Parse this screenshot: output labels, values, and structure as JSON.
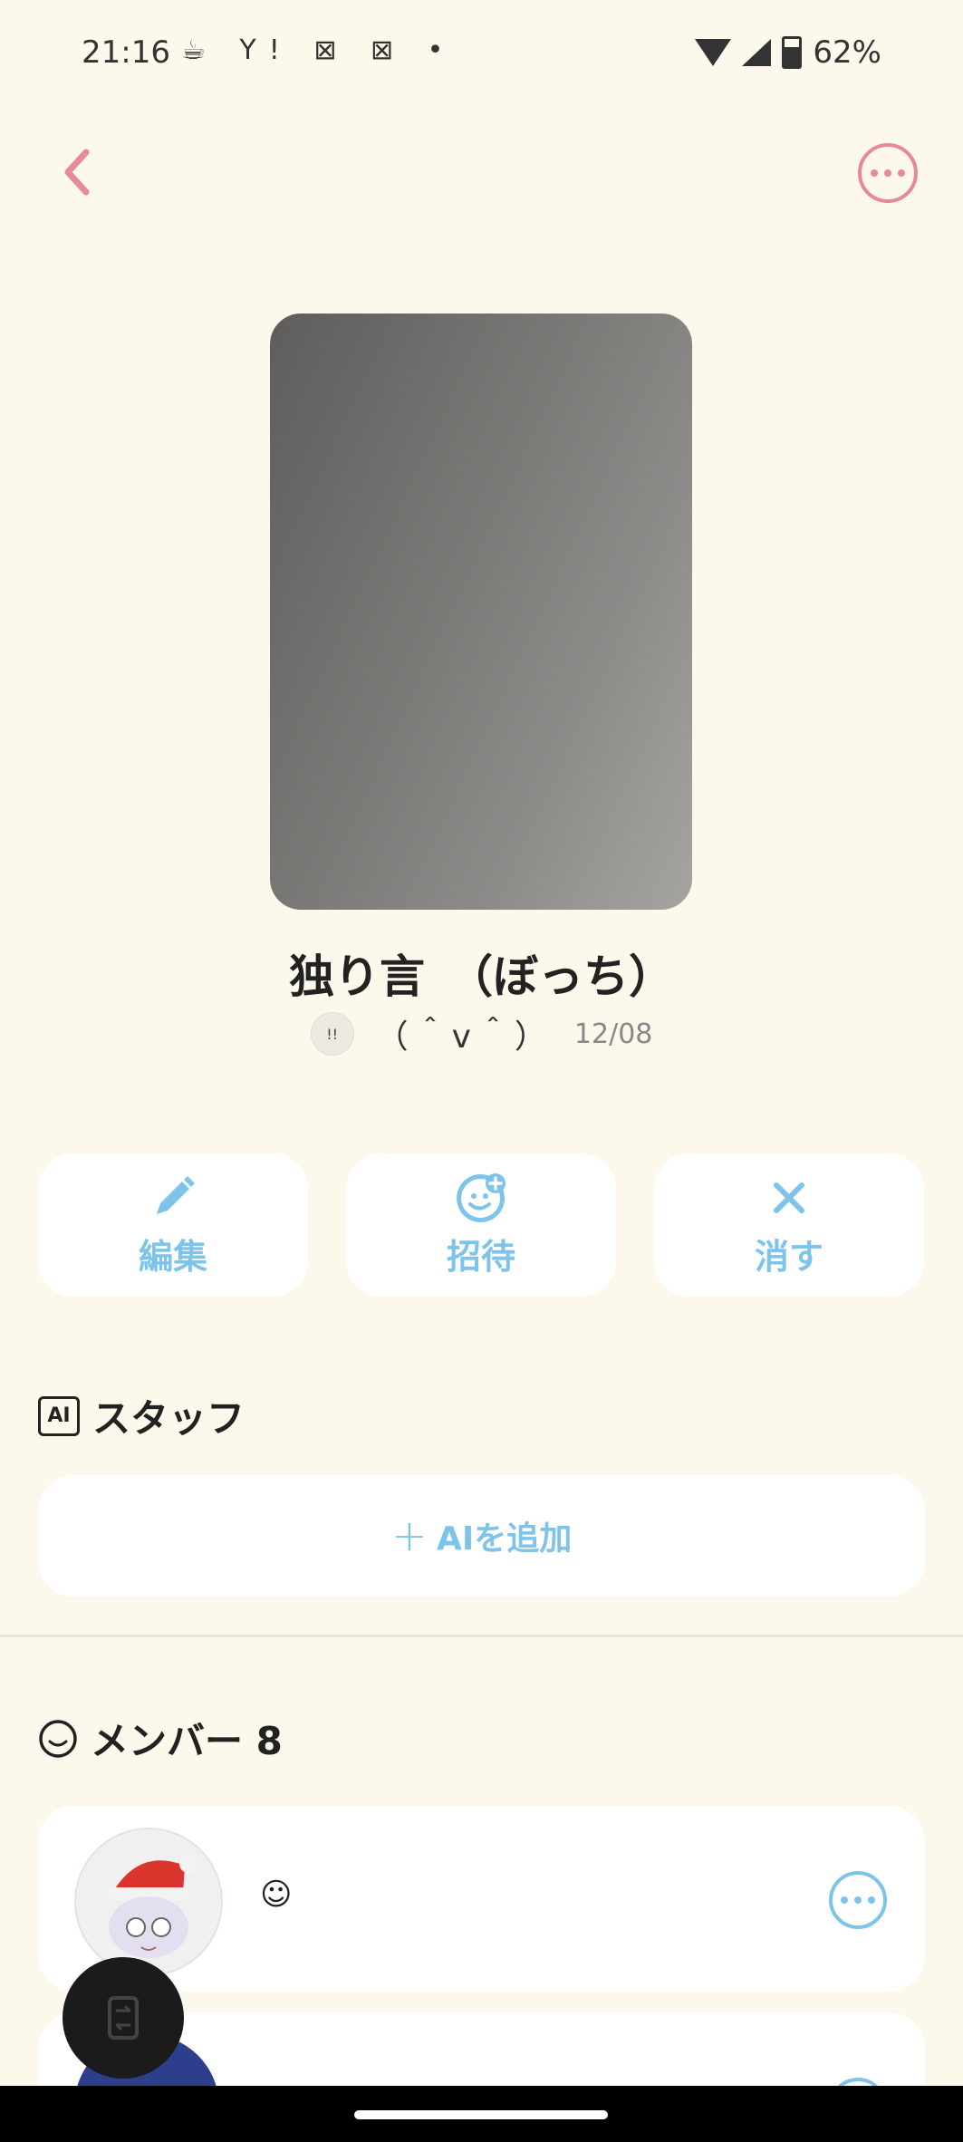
{
  "status_bar": {
    "time": "21:16",
    "notif_icons": "☕ Y! ⊠ ⊠ •",
    "battery": "62%"
  },
  "group": {
    "title": "独り言　（ぼっち）",
    "owner_name": "（＾v＾）",
    "date": "12/08"
  },
  "actions": {
    "edit": "編集",
    "invite": "招待",
    "delete": "消す"
  },
  "staff": {
    "label": "スタッフ",
    "badge": "AI",
    "add_label": "AIを追加"
  },
  "members": {
    "label": "メンバー 8",
    "items": [
      {
        "name": "☺"
      },
      {
        "name": ""
      }
    ]
  },
  "colors": {
    "accent_pink": "#e8899a",
    "accent_blue": "#7ec4ea",
    "background": "#fdf8ec"
  }
}
